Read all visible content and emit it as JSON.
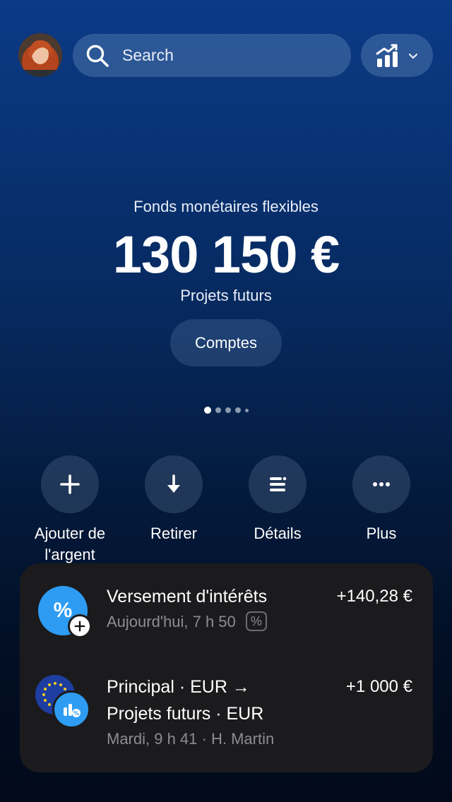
{
  "header": {
    "search_placeholder": "Search"
  },
  "balance": {
    "label": "Fonds monétaires flexibles",
    "amount": "130 150 €",
    "account_name": "Projets futurs",
    "accounts_button": "Comptes"
  },
  "pager": {
    "count": 5,
    "active_index": 0
  },
  "actions": [
    {
      "label": "Ajouter de l'argent",
      "icon": "plus-icon"
    },
    {
      "label": "Retirer",
      "icon": "arrow-down-icon"
    },
    {
      "label": "Détails",
      "icon": "details-icon"
    },
    {
      "label": "Plus",
      "icon": "more-icon"
    }
  ],
  "transactions": [
    {
      "title": "Versement d'intérêts",
      "subtitle": "Aujourd'hui, 7 h 50",
      "badge": "%",
      "amount": "+140,28 €",
      "icon": "percent-icon"
    },
    {
      "title_line1": "Principal · EUR →",
      "title_line2": "Projets futurs · EUR",
      "subtitle": "Mardi, 9 h 41 · H. Martin",
      "amount": "+1 000 €",
      "icon": "eu-flag-icon"
    }
  ],
  "colors": {
    "accent_blue": "#2e9cf3",
    "card_bg": "#1b1b1d",
    "muted_text": "#8b8d93"
  }
}
